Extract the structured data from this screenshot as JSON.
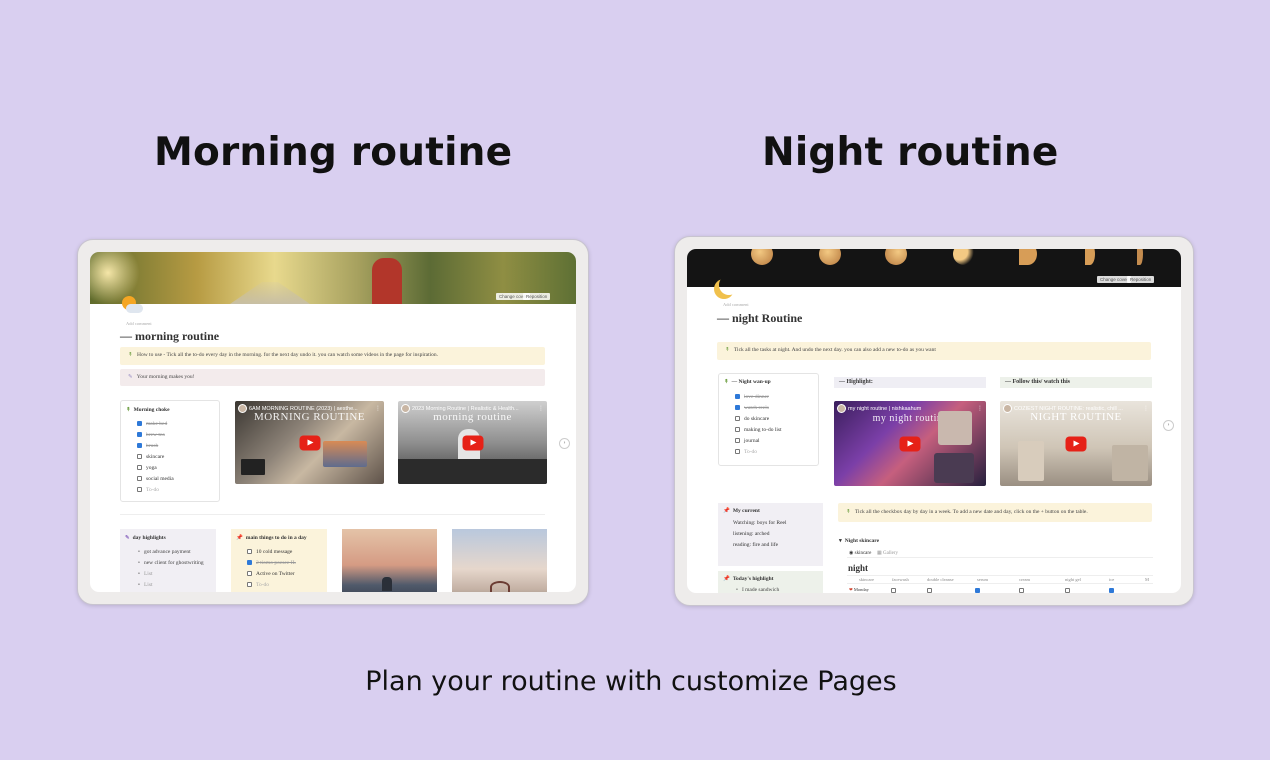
{
  "headings": {
    "morning": "Morning routine",
    "night": "Night routine",
    "tagline": "Plan your routine with customize Pages"
  },
  "colors": {
    "background": "#d9cff0",
    "checkbox": "#2e79d8",
    "youtube": "#e62117"
  },
  "morning": {
    "cover_buttons": [
      "Change cover",
      "Reposition"
    ],
    "add_comment": "Add comment",
    "page_title": "— morning routine",
    "page_icon": "sun-behind-cloud-icon",
    "callout_howto": "How to use - Tick all the to-do every day in the morning. for the next day undo it. you can watch some videos in the page for inspiration.",
    "callout_quote": "Your morning makes you!",
    "checklist_title": "Morning choke",
    "checklist": [
      {
        "label": "make bed",
        "checked": true
      },
      {
        "label": "brew tea",
        "checked": true
      },
      {
        "label": "brush",
        "checked": true
      },
      {
        "label": "skincare",
        "checked": false
      },
      {
        "label": "yoga",
        "checked": false
      },
      {
        "label": "social media",
        "checked": false
      },
      {
        "label": "To-do",
        "checked": false
      }
    ],
    "videos": [
      {
        "title": "6AM MORNING ROUTINE (2023) | aesthe...",
        "overlay": "MORNING ROUTINE"
      },
      {
        "title": "2023 Morning Routine | Realistic & Health...",
        "overlay": "morning routine"
      }
    ],
    "highlights_title": "day highlights",
    "highlights": [
      "got advance payment",
      "new client for ghostwriting",
      "List",
      "List"
    ],
    "main_title": "main things to do in a day",
    "main_items": [
      {
        "label": "10 cold message",
        "checked": false
      },
      {
        "label": "2 tiomo poesee IL",
        "checked": true
      },
      {
        "label": "Active on Twitter",
        "checked": false
      },
      {
        "label": "To-do",
        "checked": false
      }
    ]
  },
  "night": {
    "cover_buttons": [
      "Change cover",
      "Reposition"
    ],
    "add_comment": "Add comment",
    "page_title": "— night Routine",
    "page_icon": "crescent-moon-icon",
    "callout": "Tick all the tasks at night. And undo the next day. you can also add a new to-do as you want",
    "checklist_title": "— Night wan-up",
    "checklist": [
      {
        "label": "love dinner",
        "checked": true
      },
      {
        "label": "watch reels",
        "checked": true
      },
      {
        "label": "do skincare",
        "checked": false
      },
      {
        "label": "making to-do list",
        "checked": false
      },
      {
        "label": "journal",
        "checked": false
      },
      {
        "label": "To-do",
        "checked": false
      }
    ],
    "highlight_header": "— Highlight:",
    "follow_header": "— Follow this/ watch this",
    "videos": [
      {
        "title": "my night routine | nishkaahum",
        "overlay": "my night routine"
      },
      {
        "title": "COZIEST NIGHT ROUTINE: realistic, chill ...",
        "overlay": "NIGHT ROUTINE"
      }
    ],
    "current_title": "My current",
    "current_items": [
      "Watching: boys for Reel",
      "listening: arched",
      "reading: fire and life"
    ],
    "todays_title": "Today's highlight",
    "todays_items": [
      "I made sandwich"
    ],
    "callout2": "Tick all the checkbox day by day in a week. To add a new date and day, click on the + button on the table.",
    "db_title": "Night skincare",
    "db_tabs": [
      "skincare",
      "Gallery"
    ],
    "db_heading": "night",
    "db_columns": [
      "skincare",
      "facewash",
      "double cleanse",
      "serum",
      "cream",
      "night gel",
      "ice",
      "M"
    ],
    "db_rows": [
      {
        "day": "Monday",
        "checks": [
          false,
          false,
          true,
          false,
          false,
          true
        ]
      }
    ]
  }
}
